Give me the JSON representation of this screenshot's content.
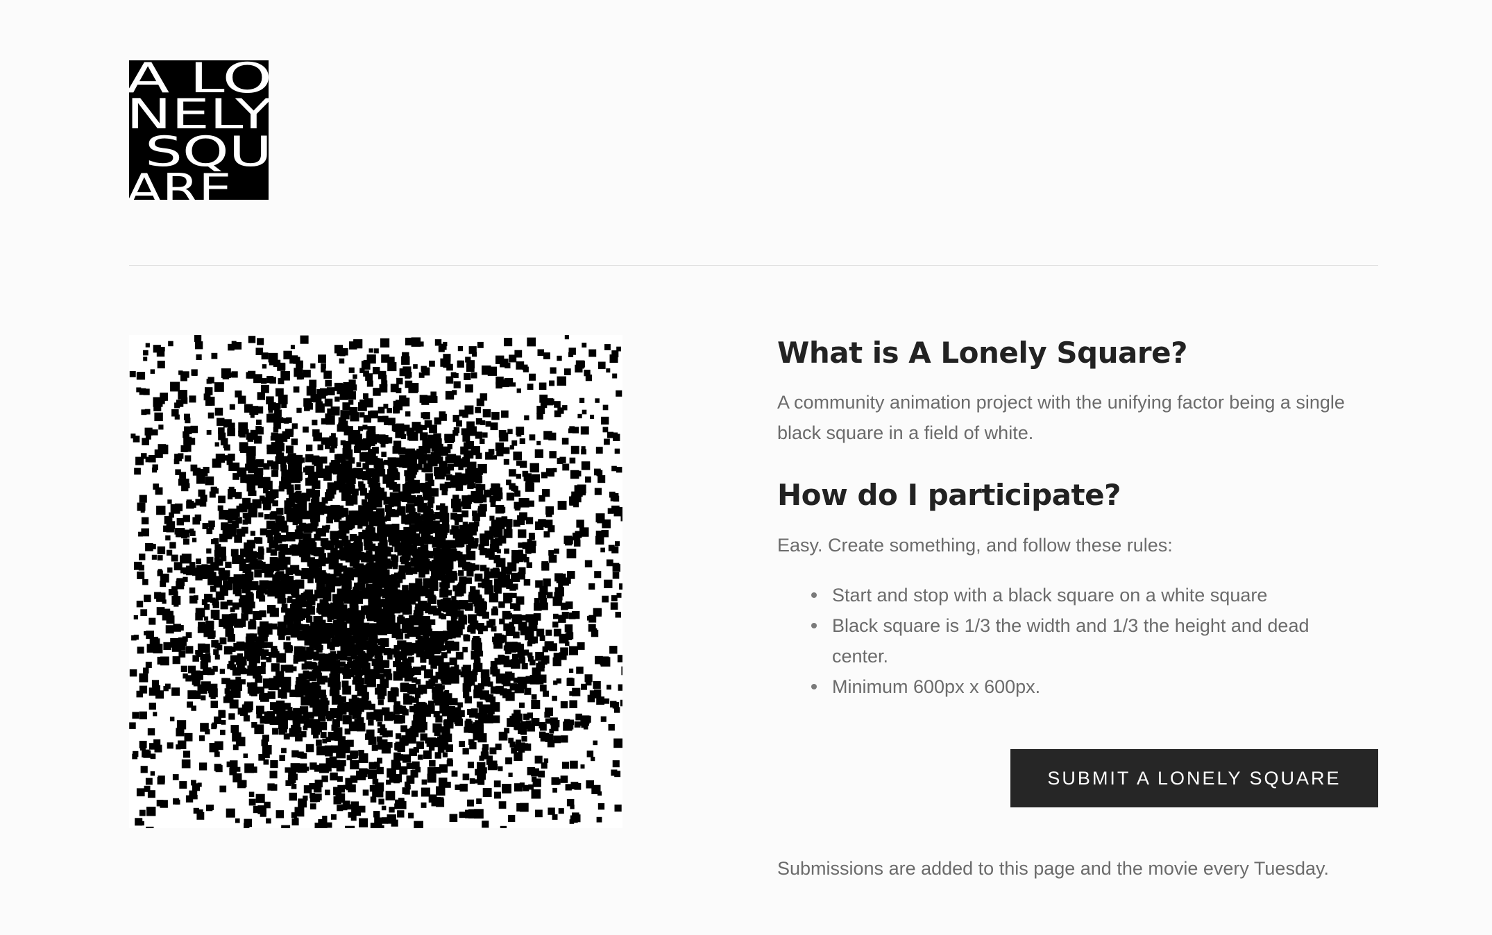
{
  "logo": {
    "lines": [
      "A LO",
      "NELY",
      " SQU",
      "ARE"
    ],
    "background": "#000000",
    "text_color": "#ffffff"
  },
  "artwork": {
    "description_icon": "scattered-squares-artwork",
    "square_color": "#000000",
    "background": "#ffffff"
  },
  "about": {
    "title": "What is A Lonely Square?",
    "body": "A community animation project with the unifying factor being a single black square in a field of white."
  },
  "participate": {
    "title": "How do I participate?",
    "intro": "Easy. Create something, and follow these rules:",
    "rules": [
      "Start and stop with a black square on a white square",
      "Black square is 1/3 the width and 1/3 the height and dead center.",
      "Minimum 600px x 600px."
    ]
  },
  "submit_button": {
    "label": "SUBMIT A LONELY SQUARE",
    "background": "#262626"
  },
  "footer_note": "Submissions are added to this page and the movie every Tuesday."
}
